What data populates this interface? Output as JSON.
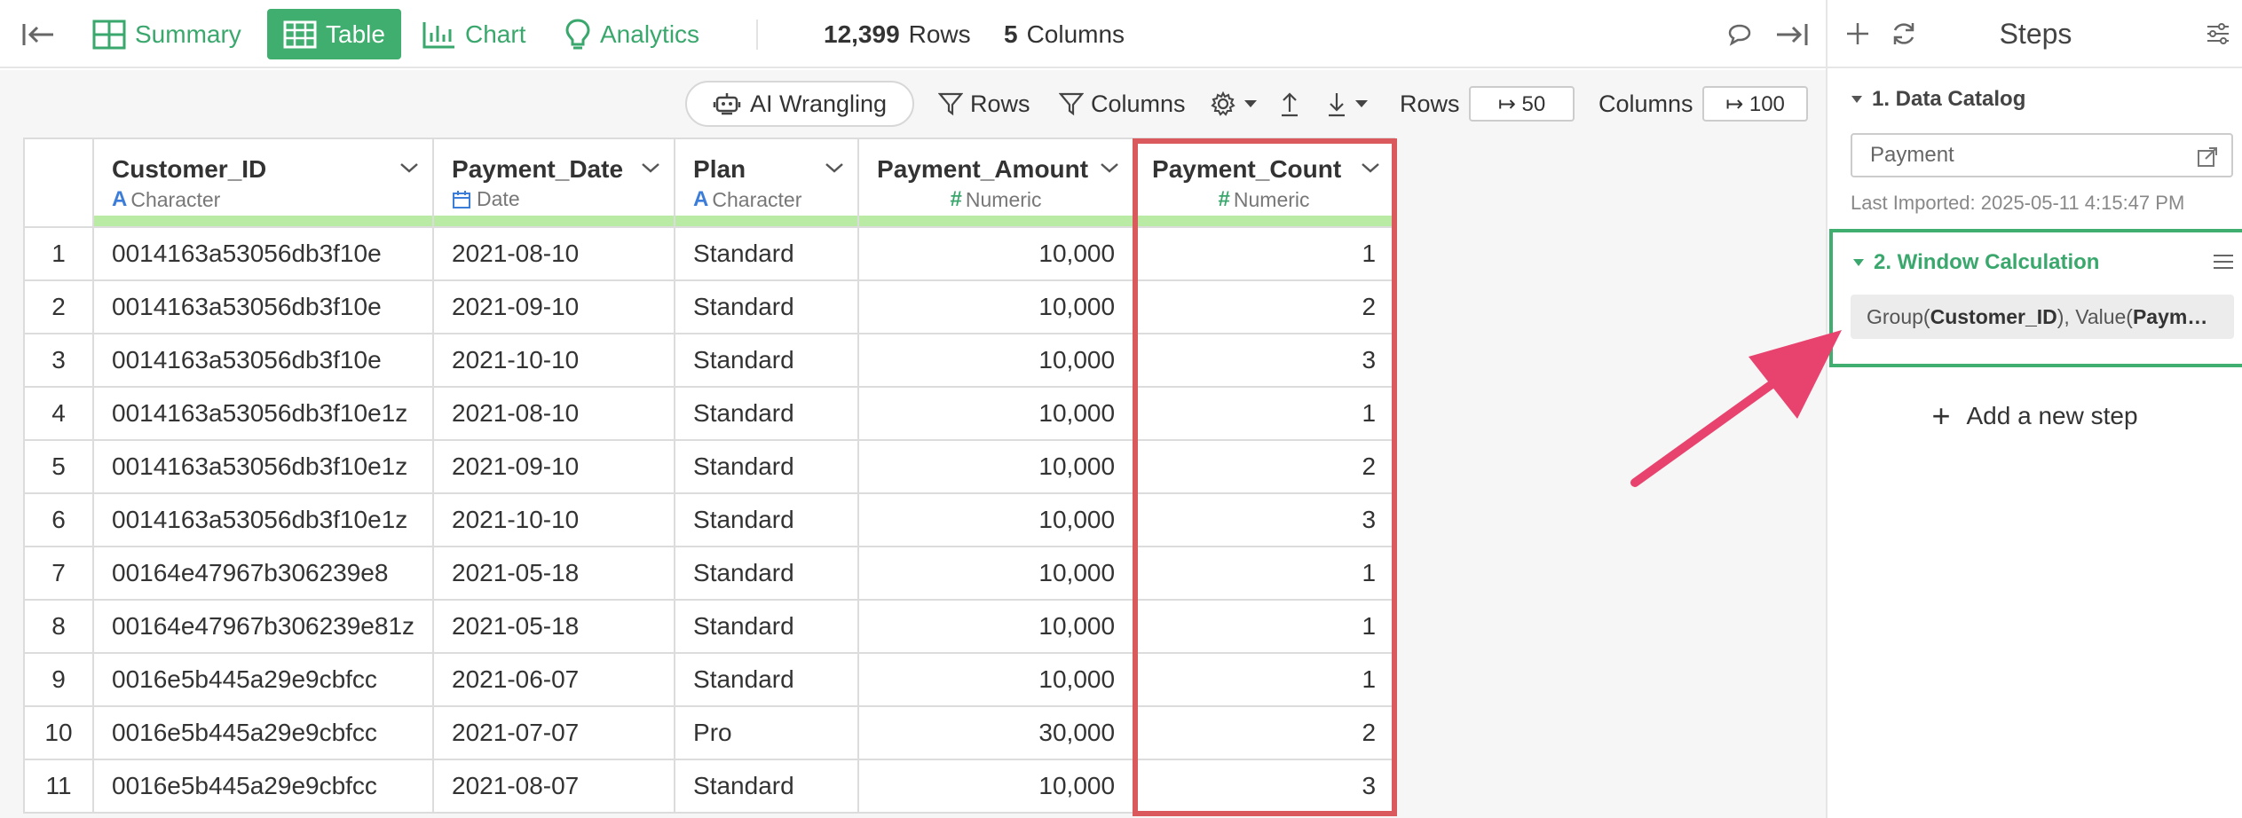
{
  "toolbar": {
    "nav": {
      "summary": "Summary",
      "table": "Table",
      "chart": "Chart",
      "analytics": "Analytics"
    },
    "rows_count": "12,399",
    "rows_unit": "Rows",
    "cols_count": "5",
    "cols_unit": "Columns"
  },
  "subtoolbar": {
    "ai_wrangling": "AI Wrangling",
    "filter_rows": "Rows",
    "filter_columns": "Columns",
    "rows_label": "Rows",
    "rows_limit": "↦ 50",
    "columns_label": "Columns",
    "columns_limit": "↦ 100"
  },
  "table": {
    "columns": [
      {
        "name": "Customer_ID",
        "type": "Character",
        "type_glyph": "A"
      },
      {
        "name": "Payment_Date",
        "type": "Date",
        "type_glyph": "date-icon"
      },
      {
        "name": "Plan",
        "type": "Character",
        "type_glyph": "A"
      },
      {
        "name": "Payment_Amount",
        "type": "Numeric",
        "type_glyph": "#"
      },
      {
        "name": "Payment_Count",
        "type": "Numeric",
        "type_glyph": "#"
      }
    ],
    "rows": [
      [
        "1",
        "0014163a53056db3f10e",
        "2021-08-10",
        "Standard",
        "10,000",
        "1"
      ],
      [
        "2",
        "0014163a53056db3f10e",
        "2021-09-10",
        "Standard",
        "10,000",
        "2"
      ],
      [
        "3",
        "0014163a53056db3f10e",
        "2021-10-10",
        "Standard",
        "10,000",
        "3"
      ],
      [
        "4",
        "0014163a53056db3f10e1z",
        "2021-08-10",
        "Standard",
        "10,000",
        "1"
      ],
      [
        "5",
        "0014163a53056db3f10e1z",
        "2021-09-10",
        "Standard",
        "10,000",
        "2"
      ],
      [
        "6",
        "0014163a53056db3f10e1z",
        "2021-10-10",
        "Standard",
        "10,000",
        "3"
      ],
      [
        "7",
        "00164e47967b306239e8",
        "2021-05-18",
        "Standard",
        "10,000",
        "1"
      ],
      [
        "8",
        "00164e47967b306239e81z",
        "2021-05-18",
        "Standard",
        "10,000",
        "1"
      ],
      [
        "9",
        "0016e5b445a29e9cbfcc",
        "2021-06-07",
        "Standard",
        "10,000",
        "1"
      ],
      [
        "10",
        "0016e5b445a29e9cbfcc",
        "2021-07-07",
        "Pro",
        "30,000",
        "2"
      ],
      [
        "11",
        "0016e5b445a29e9cbfcc",
        "2021-08-07",
        "Standard",
        "10,000",
        "3"
      ]
    ]
  },
  "steps": {
    "title": "Steps",
    "step1": {
      "title": "1. Data Catalog",
      "source": "Payment",
      "last_imported": "Last Imported: 2025-05-11 4:15:47 PM"
    },
    "step2": {
      "title": "2. Window Calculation",
      "detail_prefix": "Group(",
      "detail_group": "Customer_ID",
      "detail_mid": "), Value(",
      "detail_value": "Paym…"
    },
    "add_step": "Add a new step"
  },
  "colors": {
    "accent_green": "#3fae6f",
    "highlight_red": "#d9595c",
    "arrow_pink": "#e8436e",
    "quality_bar": "#b9eba5"
  }
}
